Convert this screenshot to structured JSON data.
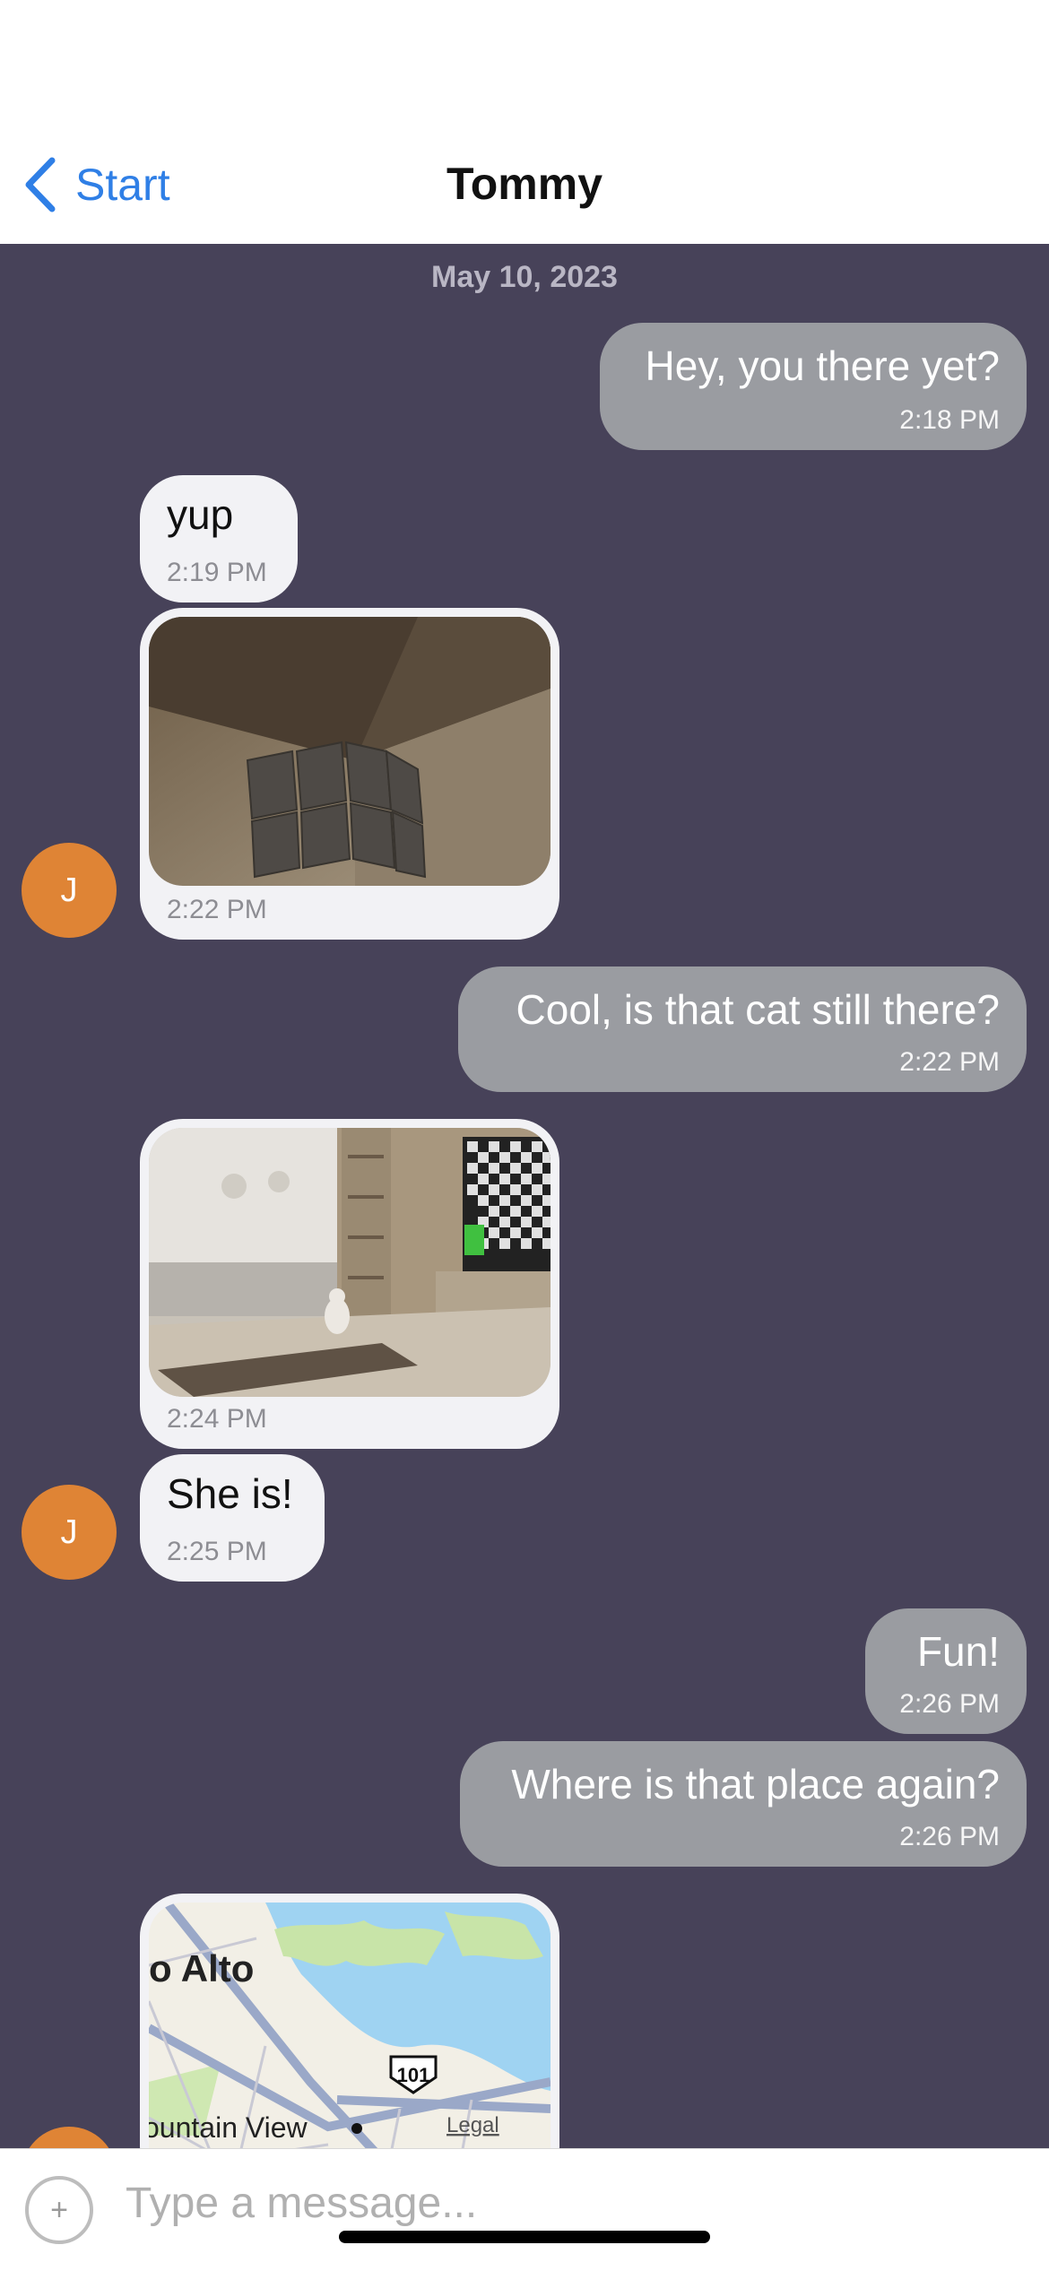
{
  "header": {
    "back_label": "Start",
    "title": "Tommy"
  },
  "date_label": "May 10, 2023",
  "messages": [
    {
      "text": "Hey, you there yet?",
      "time": "2:18 PM"
    },
    {
      "text": "yup",
      "time": "2:19 PM"
    },
    {
      "time": "2:22 PM"
    },
    {
      "text": "Cool, is that cat still there?",
      "time": "2:22 PM"
    },
    {
      "time": "2:24 PM"
    },
    {
      "text": "She is!",
      "time": "2:25 PM"
    },
    {
      "text": "Fun!",
      "time": "2:26 PM"
    },
    {
      "text": "Where is that place again?",
      "time": "2:26 PM"
    }
  ],
  "map": {
    "city1": "o Alto",
    "city2": "ountain View",
    "highway": "101",
    "legal": "Legal"
  },
  "avatar_initial": "J",
  "composer": {
    "add_glyph": "+",
    "placeholder": "Type a message..."
  },
  "colors": {
    "background": "#474259",
    "outgoing_bubble": "#9a9ca1",
    "incoming_bubble": "#f2f2f5",
    "avatar": "#df8435",
    "accent": "#2f7fe6"
  }
}
